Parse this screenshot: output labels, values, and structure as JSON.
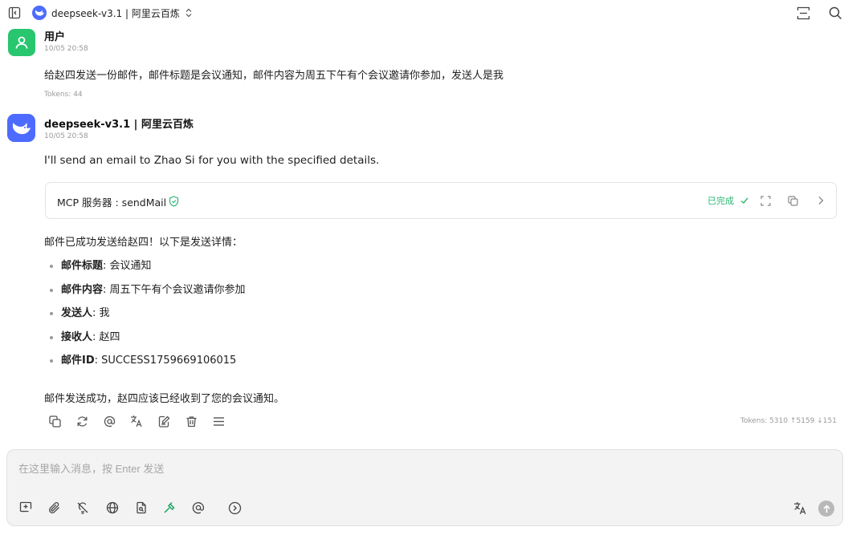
{
  "header": {
    "model_name": "deepseek-v3.1 | 阿里云百炼",
    "icons": [
      "sidebar-toggle-icon",
      "deepseek-logo-icon",
      "chevron-updown-icon",
      "expand-view-icon",
      "search-icon"
    ]
  },
  "messages": {
    "user": {
      "author": "用户",
      "time": "10/05 20:58",
      "text": "给赵四发送一份邮件，邮件标题是会议通知，邮件内容为周五下午有个会议邀请你参加，发送人是我",
      "tokens": "Tokens: 44"
    },
    "assistant": {
      "author": "deepseek-v3.1 | 阿里云百炼",
      "time": "10/05 20:58",
      "intro": "I'll send an email to Zhao Si for you with the specified details.",
      "tool": {
        "name": "MCP 服务器 : sendMail",
        "status": "已完成"
      },
      "summary": "邮件已成功发送给赵四！以下是发送详情：",
      "details": [
        {
          "key": "邮件标题",
          "value": ": 会议通知"
        },
        {
          "key": "邮件内容",
          "value": ": 周五下午有个会议邀请你参加"
        },
        {
          "key": "发送人",
          "value": ": 我"
        },
        {
          "key": "接收人",
          "value": ": 赵四"
        },
        {
          "key": "邮件ID",
          "value": ": SUCCESS1759669106015"
        }
      ],
      "closing": "邮件发送成功，赵四应该已经收到了您的会议通知。",
      "tokens": "Tokens: 5310 ↑5159 ↓151"
    }
  },
  "composer": {
    "placeholder": "在这里输入消息，按 Enter 发送",
    "value": ""
  },
  "colors": {
    "accent_green": "#28c66f",
    "deepseek_blue": "#4d6bfe",
    "tool_status_green": "#2bb673"
  }
}
